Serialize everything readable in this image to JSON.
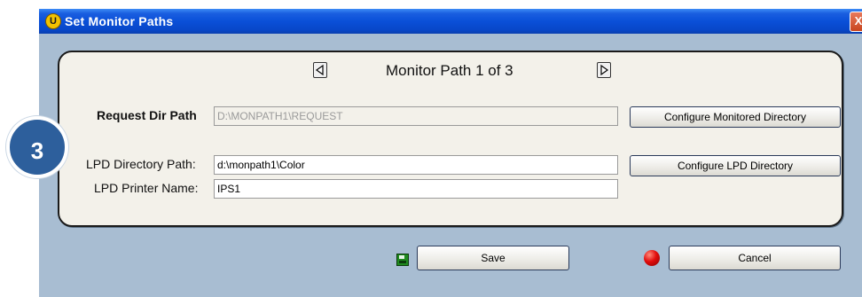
{
  "window": {
    "title": "Set Monitor Paths",
    "title_icon": "U",
    "close_glyph": "X"
  },
  "nav": {
    "prev_icon": "left-triangle-icon",
    "next_icon": "right-triangle-icon",
    "title": "Monitor Path 1 of 3"
  },
  "request": {
    "label": "Request Dir Path",
    "value": "D:\\MONPATH1\\REQUEST",
    "button": "Configure Monitored Directory"
  },
  "lpd": {
    "dir_label": "LPD Directory Path:",
    "dir_value": "d:\\monpath1\\Color",
    "dir_button": "Configure LPD Directory",
    "printer_label": "LPD Printer Name:",
    "printer_value": "IPS1"
  },
  "actions": {
    "save_label": "Save",
    "save_icon": "floppy-disk-icon",
    "cancel_label": "Cancel",
    "cancel_icon": "red-circle-icon"
  },
  "step_badge": "3",
  "colors": {
    "titlebar": "#0a4fd8",
    "client_bg": "#a8bdd2",
    "panel_bg": "#f3f1ea",
    "badge_bg": "#2d5f9c"
  }
}
